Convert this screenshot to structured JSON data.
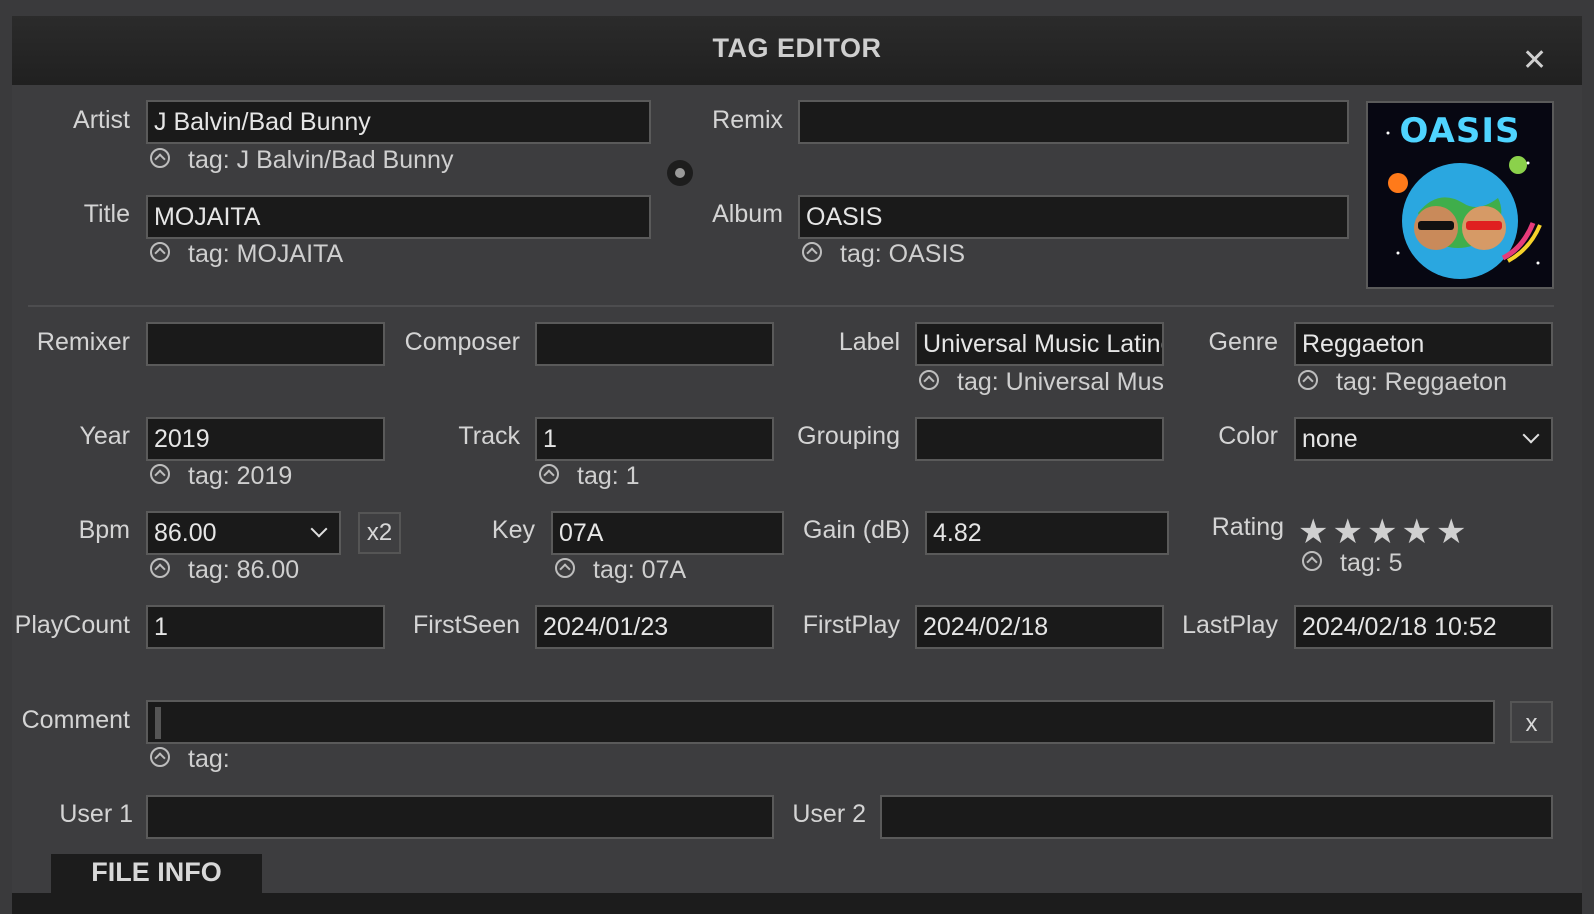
{
  "window": {
    "title": "TAG EDITOR",
    "close_glyph": "✕"
  },
  "fields": {
    "artist": {
      "label": "Artist",
      "value": "J Balvin/Bad Bunny",
      "tag": "tag: J Balvin/Bad Bunny"
    },
    "remix": {
      "label": "Remix",
      "value": ""
    },
    "title": {
      "label": "Title",
      "value": "MOJAITA",
      "tag": "tag: MOJAITA"
    },
    "album": {
      "label": "Album",
      "value": "OASIS",
      "tag": "tag: OASIS"
    },
    "remixer": {
      "label": "Remixer",
      "value": ""
    },
    "composer": {
      "label": "Composer",
      "value": ""
    },
    "label": {
      "label": "Label",
      "value": "Universal Music Latino",
      "tag": "tag: Universal Music Latino"
    },
    "genre": {
      "label": "Genre",
      "value": "Reggaeton",
      "tag": "tag: Reggaeton"
    },
    "year": {
      "label": "Year",
      "value": "2019",
      "tag": "tag: 2019"
    },
    "track": {
      "label": "Track",
      "value": "1",
      "tag": "tag: 1"
    },
    "grouping": {
      "label": "Grouping",
      "value": ""
    },
    "color": {
      "label": "Color",
      "value": "none"
    },
    "bpm": {
      "label": "Bpm",
      "value": "86.00",
      "tag": "tag: 86.00",
      "x2_label": "x2"
    },
    "key": {
      "label": "Key",
      "value": "07A",
      "tag": "tag: 07A"
    },
    "gain": {
      "label": "Gain (dB)",
      "value": "4.82"
    },
    "rating": {
      "label": "Rating",
      "stars": 5,
      "max": 5,
      "tag": "tag: 5"
    },
    "playcount": {
      "label": "PlayCount",
      "value": "1"
    },
    "firstseen": {
      "label": "FirstSeen",
      "value": "2024/01/23"
    },
    "firstplay": {
      "label": "FirstPlay",
      "value": "2024/02/18"
    },
    "lastplay": {
      "label": "LastPlay",
      "value": "2024/02/18 10:52"
    },
    "comment": {
      "label": "Comment",
      "value": "",
      "tag": "tag:",
      "clear_label": "x"
    },
    "user1": {
      "label": "User 1",
      "value": ""
    },
    "user2": {
      "label": "User 2",
      "value": ""
    }
  },
  "artwork": {
    "text": "OASIS"
  },
  "tabs": {
    "file_info": "FILE INFO"
  },
  "icons": {
    "close": "close-icon",
    "tag": "tag-restore-icon",
    "dropdown": "chevron-down-icon",
    "star": "star-icon"
  }
}
